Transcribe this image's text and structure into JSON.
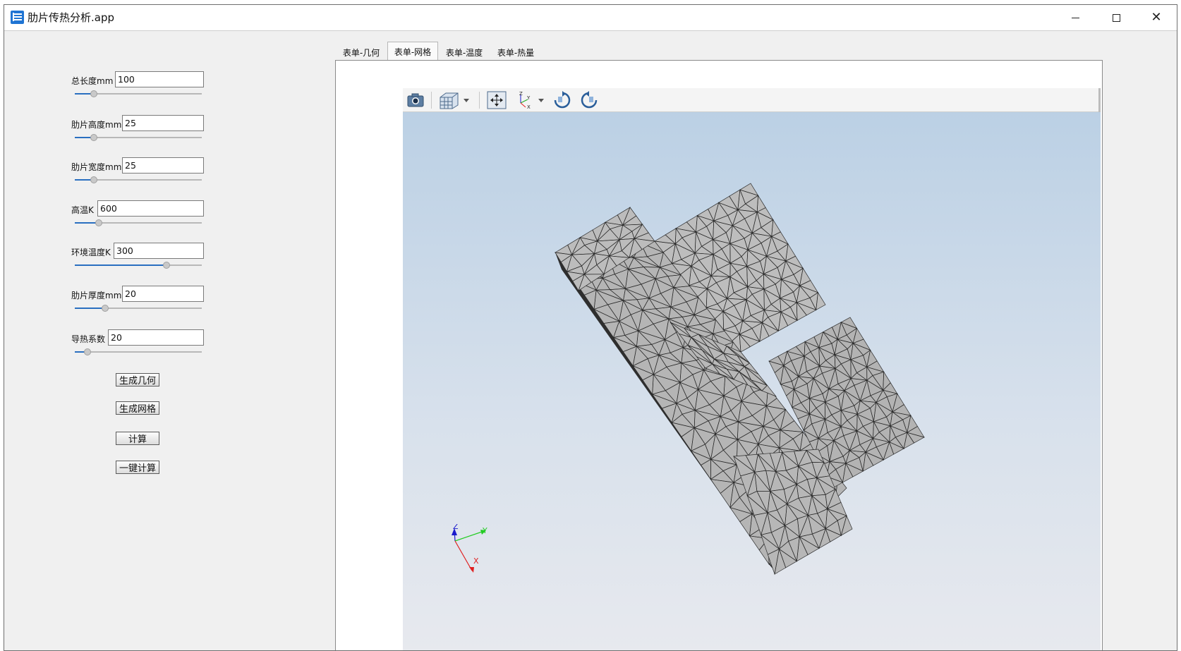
{
  "window": {
    "title": "肋片传热分析.app",
    "min_icon": "minimize-icon",
    "max_icon": "maximize-icon",
    "close_icon": "close-icon"
  },
  "params": [
    {
      "id": "total-length",
      "label": "总长度mm",
      "value": "100",
      "slider": 0.15
    },
    {
      "id": "fin-height",
      "label": "肋片高度mm",
      "value": "25",
      "slider": 0.15
    },
    {
      "id": "fin-width",
      "label": "肋片宽度mm",
      "value": "25",
      "slider": 0.15
    },
    {
      "id": "high-temp",
      "label": "高温K",
      "value": "600",
      "slider": 0.19
    },
    {
      "id": "ambient-temp",
      "label": "环境温度K",
      "value": "300",
      "slider": 0.72
    },
    {
      "id": "fin-thickness",
      "label": "肋片厚度mm",
      "value": "20",
      "slider": 0.24
    },
    {
      "id": "conductivity",
      "label": "导热系数",
      "value": "20",
      "slider": 0.1
    }
  ],
  "buttons": {
    "gen_geometry": "生成几何",
    "gen_mesh": "生成网格",
    "compute": "计算",
    "one_click": "一键计算"
  },
  "tabs": [
    {
      "label": "表单-几何",
      "active": false
    },
    {
      "label": "表单-网格",
      "active": true
    },
    {
      "label": "表单-温度",
      "active": false
    },
    {
      "label": "表单-热量",
      "active": false
    }
  ],
  "toolbar": {
    "icons": [
      "camera-icon",
      "view-cube-icon",
      "zoom-extents-icon",
      "axis-orientation-icon",
      "rotate-cw-icon",
      "rotate-ccw-icon"
    ]
  },
  "axes": {
    "x": "x",
    "y": "y",
    "z": "z",
    "x_label": "X",
    "y_label": "Y",
    "z_label": "Z"
  },
  "colors": {
    "accent": "#2a6fc0",
    "mesh_face": "#b8b8b8",
    "mesh_dark": "#2a2a2a",
    "viewer_top": "#b9cfe4",
    "viewer_bottom": "#e7e9ee",
    "axis_x": "#e02020",
    "axis_y": "#22cc22",
    "axis_z": "#1a1acc"
  }
}
